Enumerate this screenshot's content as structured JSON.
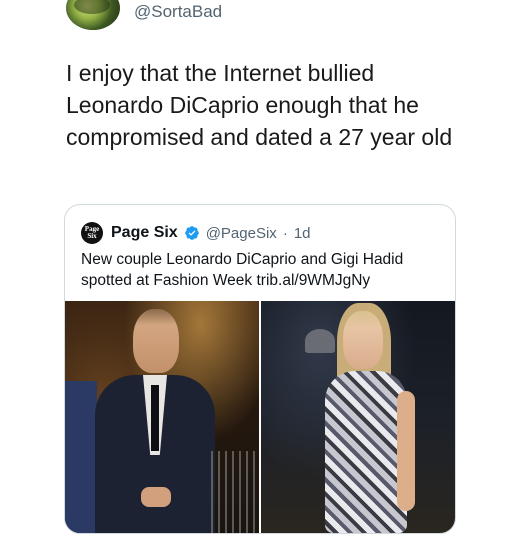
{
  "tweet": {
    "handle": "@SortaBad",
    "text": "I enjoy that the Internet bullied Leonardo DiCaprio enough that he compromised and dated a 27 year old"
  },
  "quoted_tweet": {
    "logo_text": "Page Six",
    "name": "Page Six",
    "verified": true,
    "handle": "@PageSix",
    "separator": "·",
    "time": "1d",
    "text": "New couple Leonardo DiCaprio and Gigi Hadid spotted at Fashion Week trib.al/9WMJgNy",
    "photo_count": 2
  },
  "colors": {
    "text_primary": "#0f1419",
    "text_secondary": "#536471",
    "verified_blue": "#1d9bf0",
    "card_border": "#cfd9de"
  },
  "icons": {
    "verified": "verified-badge-icon"
  }
}
